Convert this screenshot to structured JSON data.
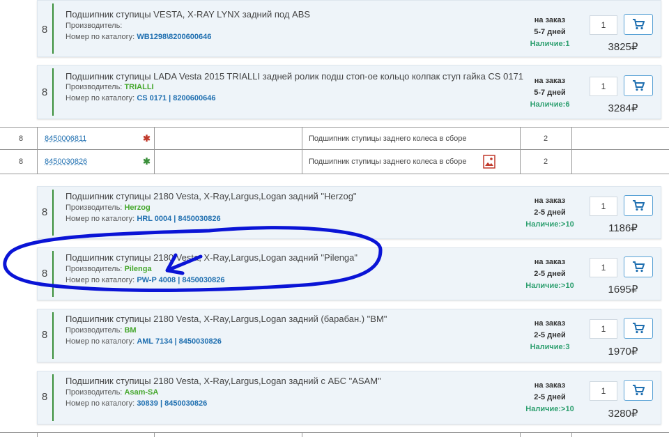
{
  "cards": [
    {
      "num": "8",
      "title": "Подшипник ступицы VESTA, X-RAY LYNX задний под ABS",
      "mfr_label": "Производитель:",
      "mfr": "",
      "cat_label": "Номер по каталогу:",
      "cat": "WB1298\\8200600646",
      "status1": "на заказ",
      "status2": "5-7 дней",
      "avail_label": "Наличие:",
      "avail": "1",
      "qty": "1",
      "price": "3825₽"
    },
    {
      "num": "8",
      "title": "Подшипник ступицы LADA Vesta 2015 TRIALLI задней ролик подш стоп-ое кольцо колпак ступ гайка CS 0171",
      "mfr_label": "Производитель:",
      "mfr": "TRIALLI",
      "cat_label": "Номер по каталогу:",
      "cat": "CS 0171 | 8200600646",
      "status1": "на заказ",
      "status2": "5-7 дней",
      "avail_label": "Наличие:",
      "avail": "6",
      "qty": "1",
      "price": "3284₽"
    },
    {
      "num": "8",
      "title": "Подшипник ступицы 2180 Vesta, X-Ray,Largus,Logan задний \"Herzog\"",
      "mfr_label": "Производитель:",
      "mfr": "Herzog",
      "cat_label": "Номер по каталогу:",
      "cat": "HRL 0004 | 8450030826",
      "status1": "на заказ",
      "status2": "2-5 дней",
      "avail_label": "Наличие:",
      "avail": ">10",
      "qty": "1",
      "price": "1186₽"
    },
    {
      "num": "8",
      "title": "Подшипник ступицы 2180 Vesta, X-Ray,Largus,Logan задний \"Pilenga\"",
      "mfr_label": "Производитель:",
      "mfr": "Pilenga",
      "cat_label": "Номер по каталогу:",
      "cat": "PW-P 4008 | 8450030826",
      "status1": "на заказ",
      "status2": "2-5 дней",
      "avail_label": "Наличие:",
      "avail": ">10",
      "qty": "1",
      "price": "1695₽"
    },
    {
      "num": "8",
      "title": "Подшипник ступицы 2180 Vesta, X-Ray,Largus,Logan задний (барабан.) \"BM\"",
      "mfr_label": "Производитель:",
      "mfr": "BM",
      "cat_label": "Номер по каталогу:",
      "cat": "AML 7134 | 8450030826",
      "status1": "на заказ",
      "status2": "2-5 дней",
      "avail_label": "Наличие:",
      "avail": "3",
      "qty": "1",
      "price": "1970₽"
    },
    {
      "num": "8",
      "title": "Подшипник ступицы 2180 Vesta, X-Ray,Largus,Logan задний с АБС \"ASAM\"",
      "mfr_label": "Производитель:",
      "mfr": "Asam-SA",
      "cat_label": "Номер по каталогу:",
      "cat": "30839 | 8450030826",
      "status1": "на заказ",
      "status2": "2-5 дней",
      "avail_label": "Наличие:",
      "avail": ">10",
      "qty": "1",
      "price": "3280₽"
    }
  ],
  "table_rows": [
    {
      "num": "8",
      "part": "8450006811",
      "star_color": "#c0392b",
      "desc": "Подшипник ступицы заднего колеса в сборе",
      "qty": "2",
      "has_image": false
    },
    {
      "num": "8",
      "part": "8450030826",
      "star_color": "#3a8f3a",
      "desc": "Подшипник ступицы заднего колеса в сборе",
      "qty": "2",
      "has_image": true
    }
  ],
  "colors": {
    "accent": "#1f6fb0",
    "manufacturer": "#45a72c",
    "availability": "#2d9f6f",
    "annotation": "#0a14d6"
  }
}
